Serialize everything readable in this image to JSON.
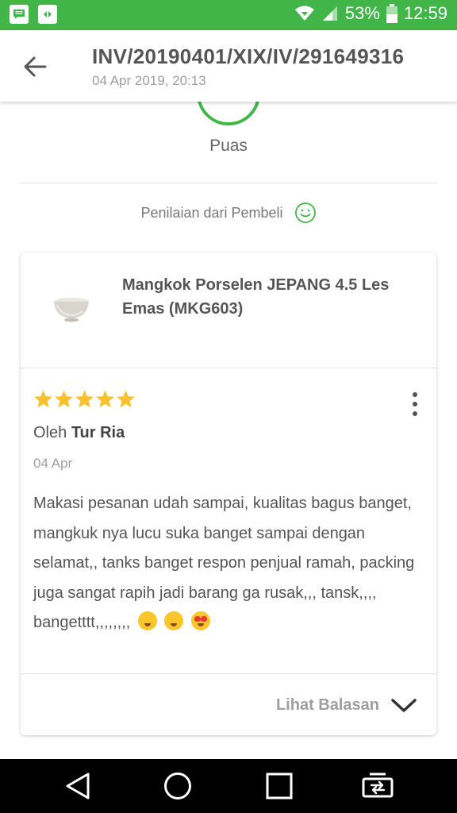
{
  "status_bar": {
    "battery": "53%",
    "time": "12:59",
    "icons": [
      "message-icon",
      "app-icon",
      "wifi-icon",
      "signal-icon",
      "battery-icon"
    ]
  },
  "header": {
    "title": "INV/20190401/XIX/IV/291649316",
    "subtitle": "04 Apr 2019, 20:13"
  },
  "rating_summary": {
    "label": "Puas"
  },
  "buyer_rating": {
    "label": "Penilaian dari Pembeli"
  },
  "product": {
    "name": "Mangkok Porselen JEPANG 4.5 Les Emas (MKG603)"
  },
  "review": {
    "stars": 5,
    "by_prefix": "Oleh",
    "author": "Tur Ria",
    "date": "04 Apr",
    "text": "Makasi pesanan udah sampai, kualitas bagus banget, mangkuk nya lucu suka banget sampai dengan selamat,, tanks banget respon penjual ramah, packing juga sangat rapih jadi barang ga rusak,,, tansk,,,, bangetttt,,,,,,,,"
  },
  "footer": {
    "see_replies": "Lihat Balasan"
  },
  "colors": {
    "brand_green": "#42b549",
    "star": "#fbc02d"
  }
}
